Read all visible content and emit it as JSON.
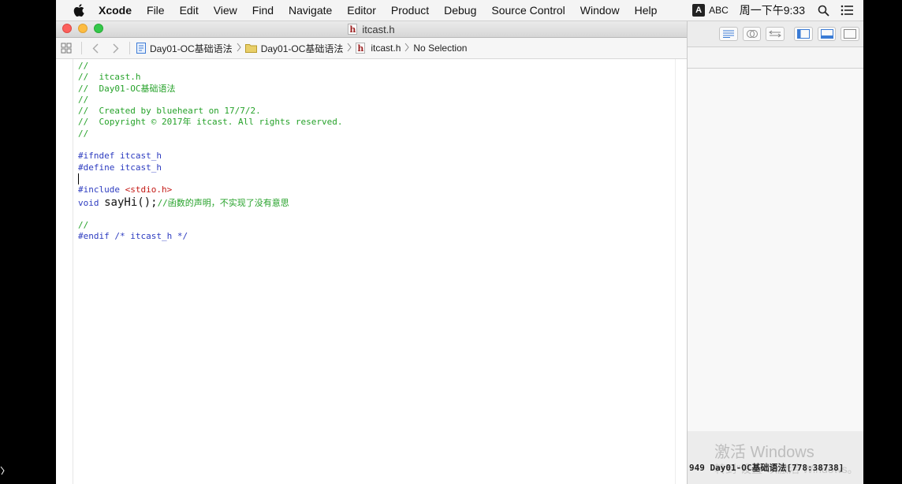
{
  "menubar": {
    "app": "Xcode",
    "items": [
      "File",
      "Edit",
      "View",
      "Find",
      "Navigate",
      "Editor",
      "Product",
      "Debug",
      "Source Control",
      "Window",
      "Help"
    ],
    "ime_badge": "A",
    "ime_label": "ABC",
    "clock": "周一下午9:33"
  },
  "window": {
    "title": "itcast.h",
    "file_icon_letter": "h"
  },
  "jumpbar": {
    "project": "Day01-OC基础语法",
    "group": "Day01-OC基础语法",
    "file": "itcast.h",
    "selection": "No Selection"
  },
  "code": {
    "c1": "//",
    "c2": "//  itcast.h",
    "c3": "//  Day01-OC基础语法",
    "c4": "//",
    "c5": "//  Created by blueheart on 17/7/2.",
    "c6": "//  Copyright © 2017年 itcast. All rights reserved.",
    "c7": "//",
    "ifndef": "#ifndef itcast_h",
    "define": "#define itcast_h",
    "include_kw": "#include ",
    "include_str": "<stdio.h>",
    "void_kw": "void ",
    "func": "sayHi();",
    "func_comment": "//函数的声明，不实现了没有意思",
    "c8": "//",
    "endif": "#endif /* itcast_h */"
  },
  "inspector": {
    "watermark": "激活 Windows",
    "watermark_sub": "转到\"设置\"以激活 Windows。",
    "status": "949 Day01-OC基础语法[778:38738]"
  }
}
